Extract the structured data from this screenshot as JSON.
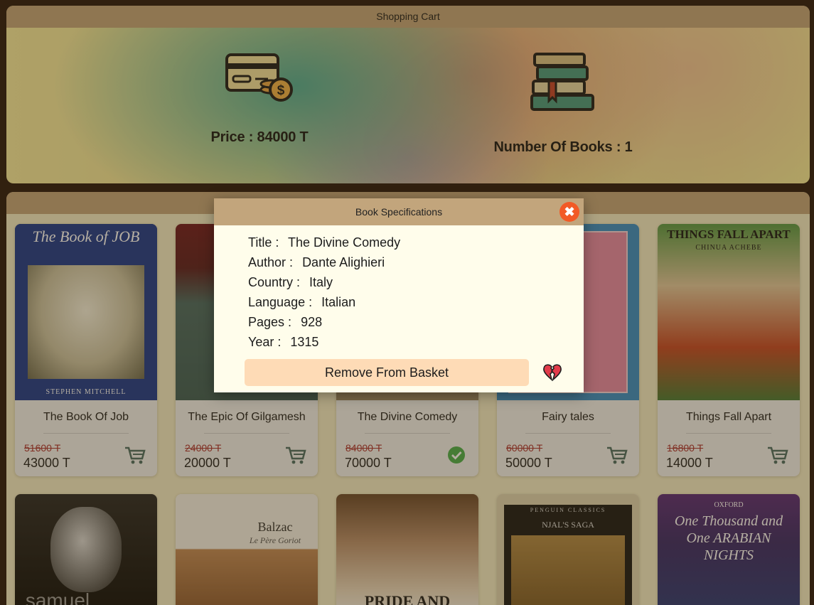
{
  "cart": {
    "title": "Shopping Cart",
    "price_text": "Price : 84000 T",
    "count_text": "Number Of Books : 1"
  },
  "books": [
    {
      "title": "The Book Of Job",
      "old_price": "51600 T",
      "new_price": "43000 T",
      "in_cart": false,
      "cover_title": "The Book of JOB",
      "cover_subtitle": "STEPHEN MITCHELL"
    },
    {
      "title": "The Epic Of Gilgamesh",
      "old_price": "24000 T",
      "new_price": "20000 T",
      "in_cart": false
    },
    {
      "title": "The Divine Comedy",
      "old_price": "84000 T",
      "new_price": "70000 T",
      "in_cart": true
    },
    {
      "title": "Fairy tales",
      "old_price": "60000 T",
      "new_price": "50000 T",
      "in_cart": false
    },
    {
      "title": "Things Fall Apart",
      "old_price": "16800 T",
      "new_price": "14000 T",
      "in_cart": false,
      "cover_title": "THINGS FALL APART",
      "cover_subtitle": "CHINUA ACHEBE"
    }
  ],
  "row2_covers": [
    {
      "cover_title": "samuel"
    },
    {
      "cover_title": "Balzac",
      "cover_subtitle": "Le Père Goriot"
    },
    {
      "cover_title": "PRIDE AND"
    },
    {
      "cover_title": "NJAL'S SAGA",
      "cover_subtitle": "PENGUIN CLASSICS"
    },
    {
      "cover_title": "One Thousand and One ARABIAN NIGHTS",
      "cover_subtitle": "OXFORD"
    }
  ],
  "modal": {
    "title": "Book Specifications",
    "close_label": "✖",
    "specs": [
      {
        "key": "Title :",
        "value": "The Divine Comedy"
      },
      {
        "key": "Author :",
        "value": "Dante Alighieri"
      },
      {
        "key": "Country :",
        "value": "Italy"
      },
      {
        "key": "Language :",
        "value": "Italian"
      },
      {
        "key": "Pages :",
        "value": "928"
      },
      {
        "key": "Year :",
        "value": "1315"
      }
    ],
    "remove_label": "Remove From Basket"
  },
  "colors": {
    "header_bar": "#c2a57c",
    "close_button": "#f25a26",
    "remove_button": "#fedbb6",
    "check_badge": "#4caf50"
  },
  "icons": {
    "price": "credit-card-coins-icon",
    "count": "book-stack-icon",
    "cart": "shopping-cart-icon",
    "in_cart": "check-circle-icon",
    "remove": "broken-heart-icon",
    "close": "close-icon"
  }
}
